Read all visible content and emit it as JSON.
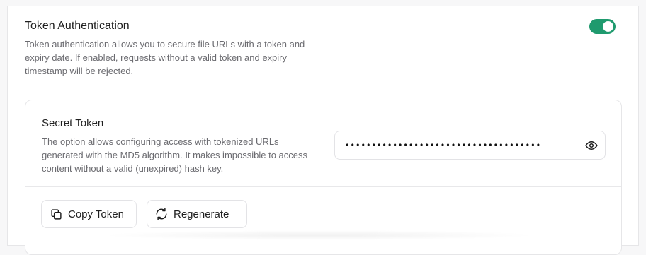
{
  "token_auth": {
    "title": "Token Authentication",
    "description": "Token authentication allows you to secure file URLs with a token and expiry date. If enabled, requests without a valid token and expiry timestamp will be rejected.",
    "enabled": true,
    "toggle_color": "#1f9a6e"
  },
  "secret_token": {
    "title": "Secret Token",
    "description": "The option allows configuring access with tokenized URLs generated with the MD5 algorithm. It makes impossible to access content without a valid (unexpired) hash key.",
    "masked_value": "•••••••••••••••••••••••••••••••••••••",
    "reveal_icon": "eye-icon"
  },
  "actions": {
    "copy_label": "Copy Token",
    "copy_icon": "copy-icon",
    "regenerate_label": "Regenerate",
    "regenerate_icon": "refresh-icon"
  }
}
